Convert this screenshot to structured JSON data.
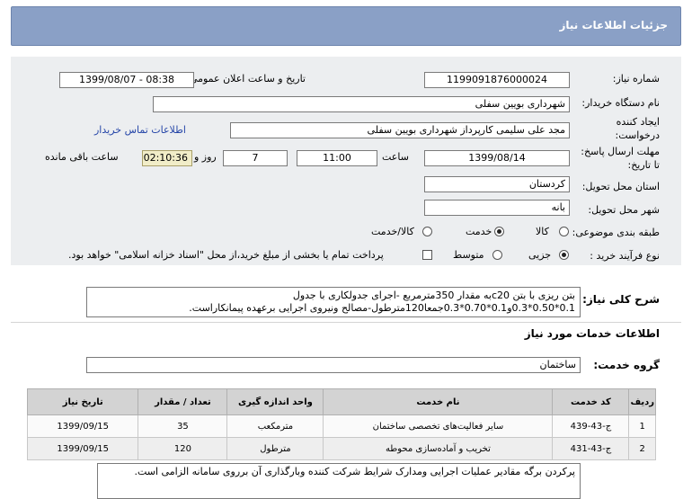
{
  "header": {
    "title": "جزئیات اطلاعات نیاز"
  },
  "fields": {
    "need_number_label": "شماره نیاز:",
    "need_number": "1199091876000024",
    "announce_label": "تاریخ و ساعت اعلان عمومی:",
    "announce_value": "1399/08/07 - 08:38",
    "buyer_label": "نام دستگاه خریدار:",
    "buyer_value": "شهرداری بویین سفلی",
    "creator_label_1": "ایجاد کننده",
    "creator_label_2": "درخواست:",
    "creator_value": "مجد علی سلیمی کارپرداز شهرداری بویین سفلی",
    "contact_link": "اطلاعات تماس خریدار",
    "deadline_label_1": "مهلت ارسال پاسخ:",
    "deadline_label_2": "تا تاریخ:",
    "deadline_date": "1399/08/14",
    "time_label": "ساعت",
    "deadline_time": "11:00",
    "days_value": "7",
    "days_label": "روز و",
    "remaining_time": "02:10:36",
    "remaining_label": "ساعت باقی مانده",
    "province_label": "استان محل تحویل:",
    "province_value": "کردستان",
    "city_label": "شهر محل تحویل:",
    "city_value": "بانه",
    "category_label": "طبقه بندی موضوعی:",
    "category_options": [
      "کالا",
      "خدمت",
      "کالا/خدمت"
    ],
    "category_selected": "خدمت",
    "purchase_label": "نوع فرآیند خرید :",
    "purchase_options": [
      "جزیی",
      "متوسط"
    ],
    "purchase_selected": "جزیی",
    "treasury_note": "پرداخت تمام یا بخشی از مبلغ خرید،از محل \"اسناد خزانه اسلامی\" خواهد بود."
  },
  "description": {
    "label": "شرح کلی نیاز:",
    "text": "بتن ریزی با بتن  c20به مقدار 350مترمربع  -اجرای جدولکاری با جدول\n0.1*0.50*0.3و0.1*0.70*0.3جمعا120مترطول-مصالح ونیروی اجرایی برعهده پیمانکاراست."
  },
  "services": {
    "section_title": "اطلاعات خدمات مورد نیاز",
    "group_label": "گروه خدمت:",
    "group_value": "ساختمان",
    "columns": [
      "ردیف",
      "کد خدمت",
      "نام خدمت",
      "واحد اندازه گیری",
      "تعداد / مقدار",
      "تاریخ نیاز"
    ],
    "rows": [
      {
        "row": "1",
        "code": "ج-43-439",
        "name": "سایر فعالیت‌های تخصصی ساختمان",
        "unit": "مترمکعب",
        "qty": "35",
        "date": "1399/09/15"
      },
      {
        "row": "2",
        "code": "ج-43-431",
        "name": "تخریب و آماده‌سازی محوطه",
        "unit": "مترطول",
        "qty": "120",
        "date": "1399/09/15"
      }
    ]
  },
  "notes": {
    "text": "پرکردن برگه  مقادیر عملیات اجرایی ومدارک شرایط شرکت کننده وبارگذاری آن برروی سامانه الزامی است."
  }
}
